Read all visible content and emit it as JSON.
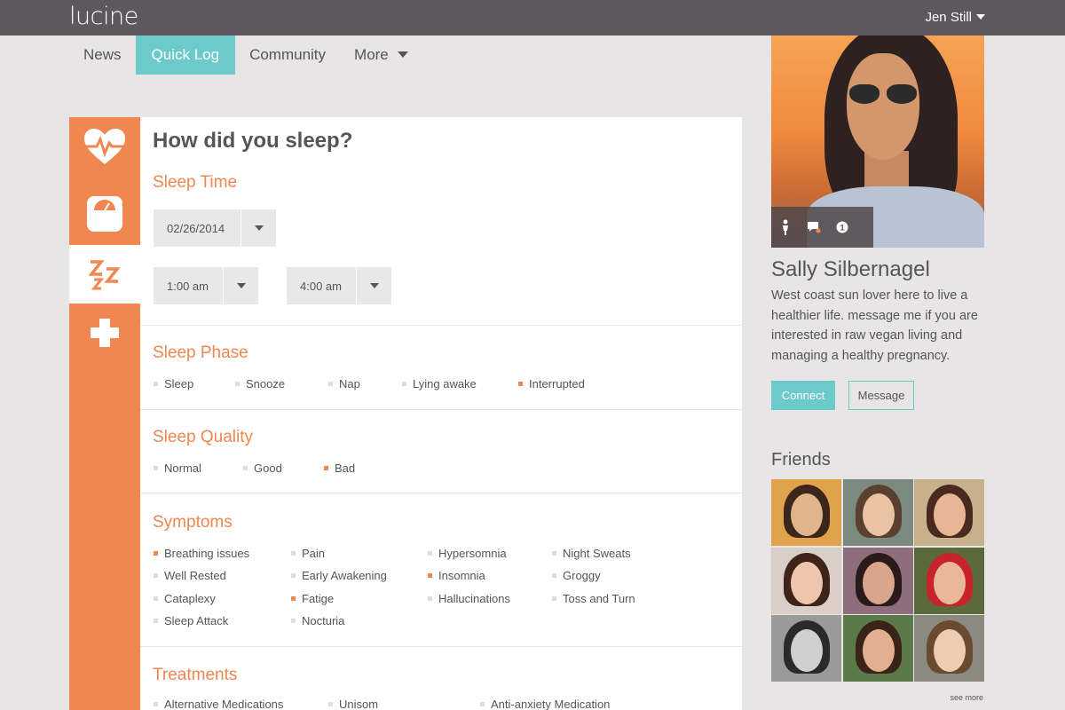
{
  "app": {
    "logo": "lucine"
  },
  "header": {
    "user_name": "Jen Still"
  },
  "nav": {
    "items": [
      {
        "label": "News"
      },
      {
        "label": "Quick Log"
      },
      {
        "label": "Community"
      },
      {
        "label": "More"
      }
    ],
    "active": "Quick Log"
  },
  "rail": {
    "icons": [
      "heart-pulse-icon",
      "scale-icon",
      "sleep-zzz-icon",
      "medical-cross-icon"
    ],
    "active": "sleep-zzz-icon"
  },
  "form": {
    "title": "How did you sleep?",
    "sleep_time": {
      "title": "Sleep Time",
      "date": "02/26/2014",
      "start": "1:00 am",
      "end": "4:00 am"
    },
    "sleep_phase": {
      "title": "Sleep Phase",
      "options": [
        {
          "label": "Sleep",
          "selected": false
        },
        {
          "label": "Snooze",
          "selected": false
        },
        {
          "label": "Nap",
          "selected": false
        },
        {
          "label": "Lying awake",
          "selected": false
        },
        {
          "label": "Interrupted",
          "selected": true
        }
      ]
    },
    "sleep_quality": {
      "title": "Sleep Quality",
      "options": [
        {
          "label": "Normal",
          "selected": false
        },
        {
          "label": "Good",
          "selected": false
        },
        {
          "label": "Bad",
          "selected": true
        }
      ]
    },
    "symptoms": {
      "title": "Symptoms",
      "options": [
        {
          "label": "Breathing issues",
          "selected": true
        },
        {
          "label": "Pain",
          "selected": false
        },
        {
          "label": "Hypersomnia",
          "selected": false
        },
        {
          "label": "Night Sweats",
          "selected": false
        },
        {
          "label": "Well Rested",
          "selected": false
        },
        {
          "label": "Early Awakening",
          "selected": false
        },
        {
          "label": "Insomnia",
          "selected": true
        },
        {
          "label": "Groggy",
          "selected": false
        },
        {
          "label": "Cataplexy",
          "selected": false
        },
        {
          "label": "Fatige",
          "selected": true
        },
        {
          "label": "Hallucinations",
          "selected": false
        },
        {
          "label": "Toss and Turn",
          "selected": false
        },
        {
          "label": "Sleep Attack",
          "selected": false
        },
        {
          "label": "Nocturia",
          "selected": false
        }
      ]
    },
    "treatments": {
      "title": "Treatments",
      "options": [
        {
          "label": "Alternative Medications",
          "selected": false
        },
        {
          "label": "Unisom",
          "selected": false
        },
        {
          "label": "Anti-anxiety Medication",
          "selected": false
        }
      ]
    }
  },
  "profile": {
    "name": "Sally Silbernagel",
    "bio": "West coast sun lover here to live a healthier life. message me if you are interested in raw vegan living and managing a healthy pregnancy.",
    "photo_icons": [
      "person-icon",
      "message-icon",
      "notification-icon"
    ],
    "notification_count": "1",
    "connect_label": "Connect",
    "message_label": "Message"
  },
  "friends": {
    "title": "Friends",
    "see_more": "see more",
    "count": 9
  },
  "colors": {
    "topbar": "#5f565e",
    "accent_orange": "#f08650",
    "accent_teal": "#6dcacb",
    "background": "#e8e5e6"
  }
}
